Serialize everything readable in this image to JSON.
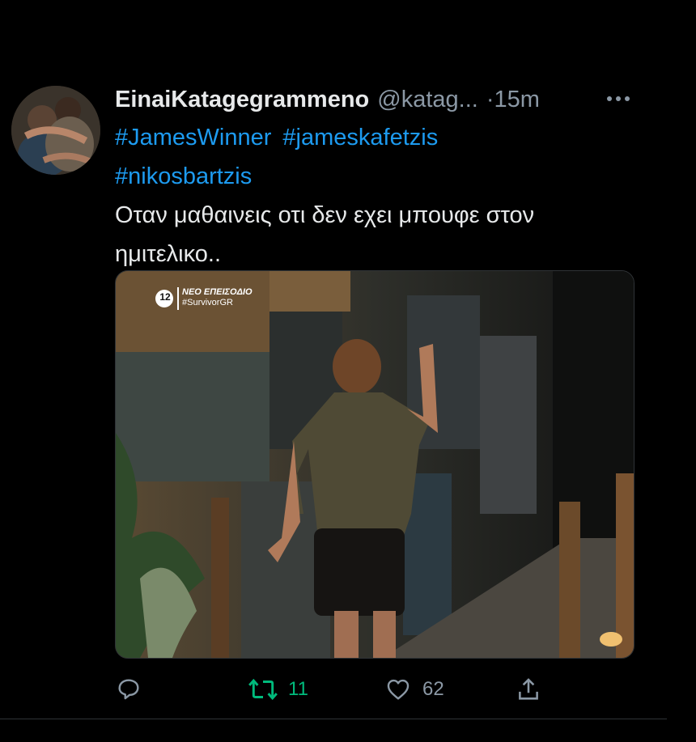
{
  "tweet": {
    "display_name": "EinaiKatagegrammeno",
    "handle": "@katag...",
    "separator": "·",
    "time": "15m",
    "hashtags": [
      "#JamesWinner",
      "#jameskafetzis",
      "#nikosbartzis"
    ],
    "body_line1": "Οταν μαθαινεις οτι δεν εχει μπουφε στον",
    "body_line2": "ημιτελικο..",
    "media": {
      "channel_logo": "12",
      "overlay_line1": "ΝΕΟ ΕΠΕΙΣΟΔΙΟ",
      "overlay_line2": "#SurvivorGR"
    },
    "actions": {
      "reply": {
        "icon": "reply-icon",
        "count": ""
      },
      "retweet": {
        "icon": "retweet-icon",
        "count": "11",
        "color": "#00ba7c"
      },
      "like": {
        "icon": "heart-icon",
        "count": "62"
      },
      "share": {
        "icon": "share-icon",
        "count": ""
      }
    }
  },
  "colors": {
    "background": "#000000",
    "link": "#1d9bf0",
    "muted": "#8b98a5",
    "text": "#e7e9ea"
  }
}
